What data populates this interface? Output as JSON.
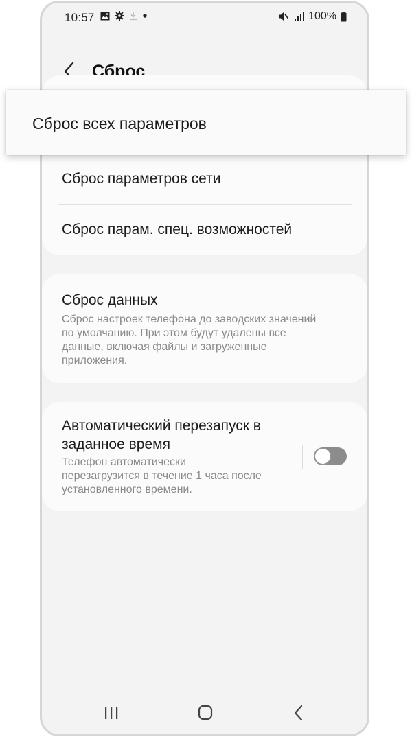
{
  "status_bar": {
    "time": "10:57",
    "battery": "100%"
  },
  "header": {
    "title": "Сброс"
  },
  "popup": {
    "label": "Сброс всех параметров"
  },
  "reset_group": {
    "items": [
      {
        "label": "Сброс параметров сети"
      },
      {
        "label": "Сброс парам. спец. возможностей"
      }
    ]
  },
  "factory_reset": {
    "title": "Сброс данных",
    "description_lines": [
      "Сброс настроек телефона до заводских значений",
      "по умолчанию. При этом будут удалены все",
      "данные, включая файлы и загруженные",
      "приложения."
    ]
  },
  "auto_restart": {
    "title_lines": [
      "Автоматический перезапуск в",
      "заданное время"
    ],
    "description_lines": [
      "Телефон автоматически",
      "перезагрузится в течение 1 часа после",
      "установленного времени."
    ],
    "enabled": false
  }
}
